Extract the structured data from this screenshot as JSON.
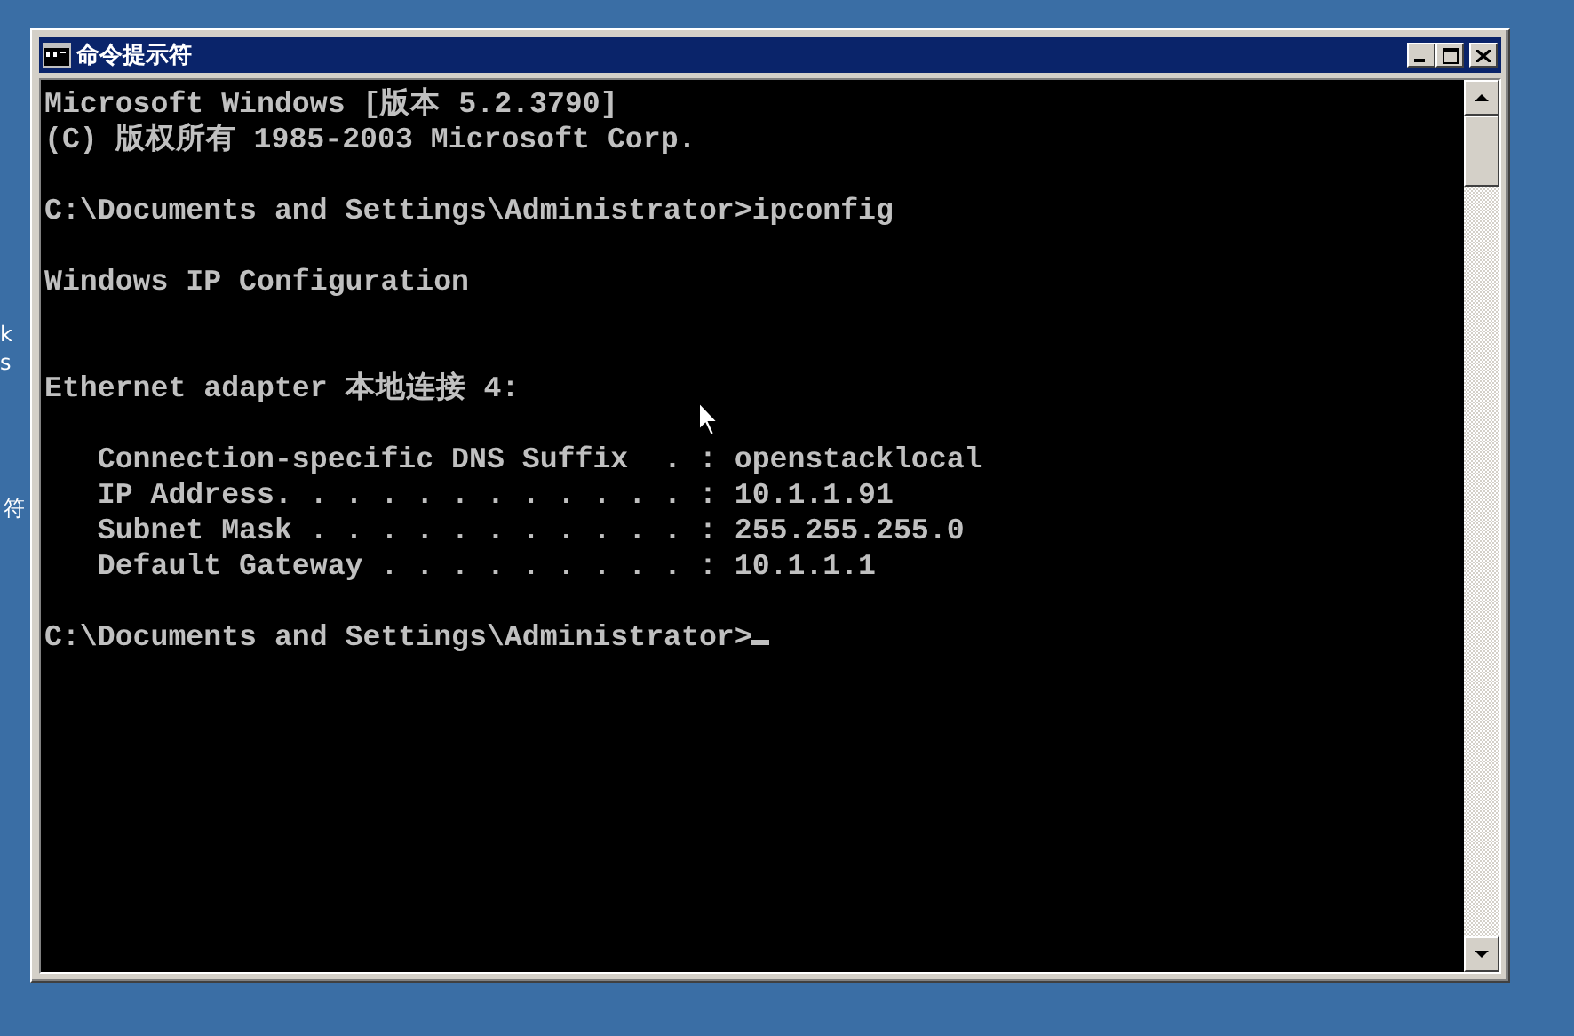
{
  "desktop": {
    "icon_labels": [
      "k",
      "s",
      "符"
    ]
  },
  "window": {
    "title": "命令提示符"
  },
  "console": {
    "lines": [
      {
        "kind": "line",
        "text": "Microsoft Windows [版本 5.2.3790]"
      },
      {
        "kind": "line",
        "text": "(C) 版权所有 1985-2003 Microsoft Corp."
      },
      {
        "kind": "blank"
      },
      {
        "kind": "line",
        "text": "C:\\Documents and Settings\\Administrator>ipconfig"
      },
      {
        "kind": "blank"
      },
      {
        "kind": "line",
        "text": "Windows IP Configuration"
      },
      {
        "kind": "blank"
      },
      {
        "kind": "blank"
      },
      {
        "kind": "line",
        "text": "Ethernet adapter 本地连接 4:"
      },
      {
        "kind": "blank"
      },
      {
        "kind": "line",
        "text": "   Connection-specific DNS Suffix  . : openstacklocal"
      },
      {
        "kind": "line",
        "text": "   IP Address. . . . . . . . . . . . : 10.1.1.91"
      },
      {
        "kind": "line",
        "text": "   Subnet Mask . . . . . . . . . . . : 255.255.255.0"
      },
      {
        "kind": "line",
        "text": "   Default Gateway . . . . . . . . . : 10.1.1.1"
      },
      {
        "kind": "blank"
      },
      {
        "kind": "line",
        "text": "C:\\Documents and Settings\\Administrator>",
        "cursor": true
      }
    ]
  }
}
